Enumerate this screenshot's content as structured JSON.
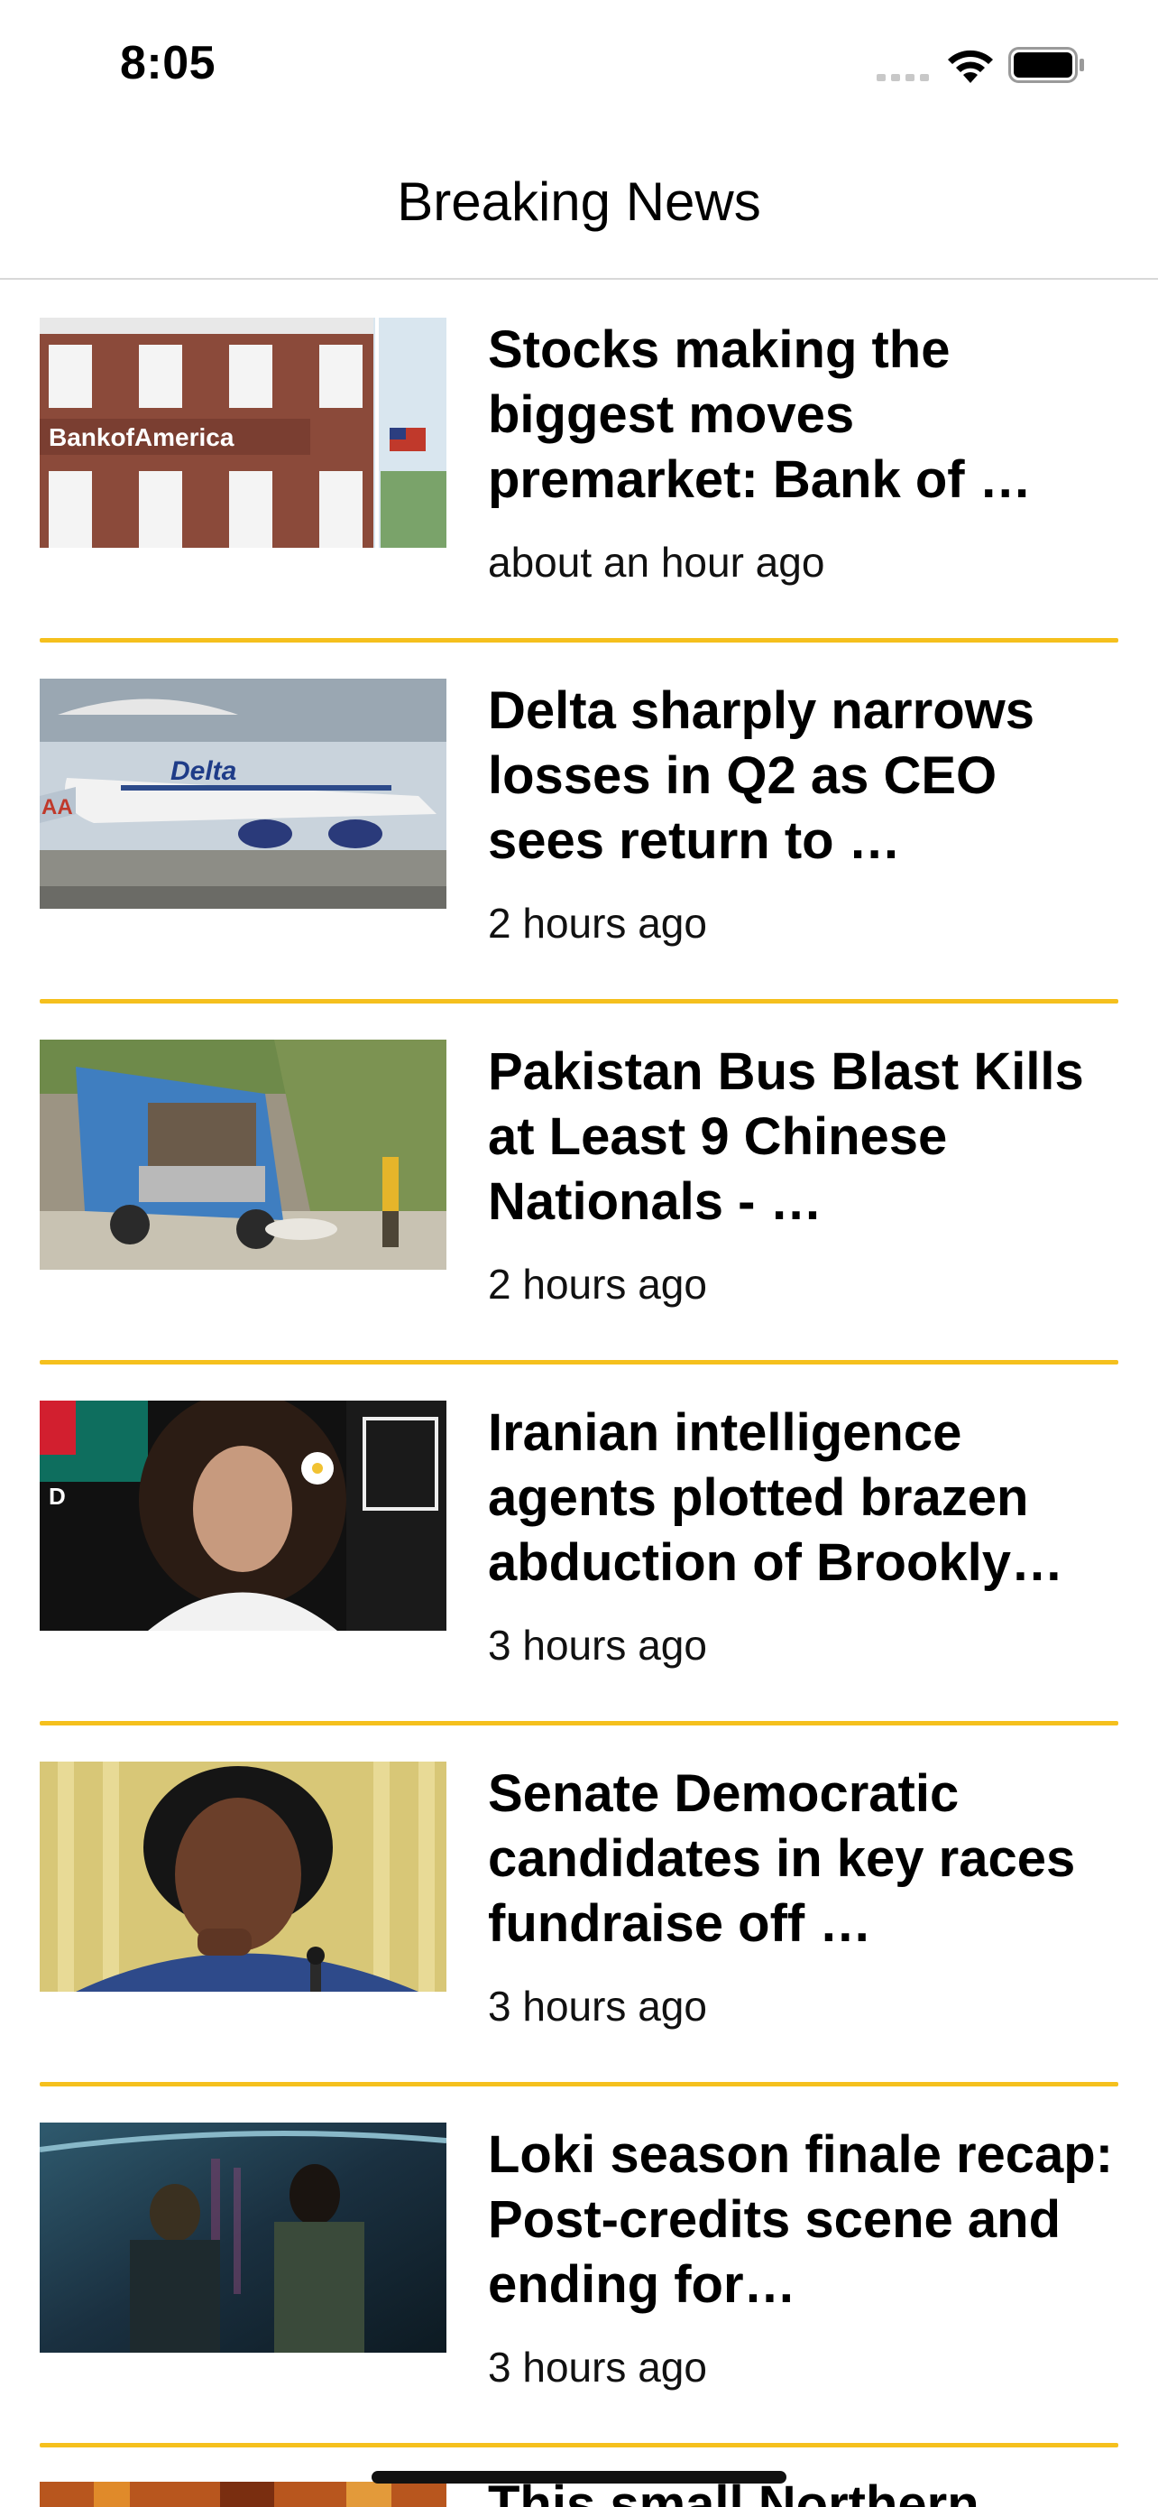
{
  "status_bar": {
    "time": "8:05",
    "icons": [
      "signal-icon",
      "wifi-icon",
      "battery-icon"
    ]
  },
  "nav": {
    "title": "Breaking News"
  },
  "theme": {
    "accent": "#f5c01d",
    "nav_border": "#d8d8d8"
  },
  "articles": [
    {
      "headline": "Stocks making the biggest moves premarket: Bank of …",
      "time": "about an hour ago",
      "image_icon": "bank-building-image"
    },
    {
      "headline": "Delta sharply narrows losses in Q2 as CEO sees return to …",
      "time": "2 hours ago",
      "image_icon": "airplane-image"
    },
    {
      "headline": "Pakistan Bus Blast Kills at Least 9 Chinese Nationals - …",
      "time": "2 hours ago",
      "image_icon": "damaged-truck-image"
    },
    {
      "headline": "Iranian intelligence agents plotted brazen abduction of Brookly…",
      "time": "3 hours ago",
      "image_icon": "woman-portrait-image"
    },
    {
      "headline": "Senate Democratic candidates in key races fundraise off …",
      "time": "3 hours ago",
      "image_icon": "senator-portrait-image"
    },
    {
      "headline": "Loki season finale recap: Post-credits scene and ending for…",
      "time": "3 hours ago",
      "image_icon": "tv-scene-image"
    }
  ],
  "peek_article": {
    "headline": "This small Northern",
    "image_icon": "wildfire-image"
  }
}
